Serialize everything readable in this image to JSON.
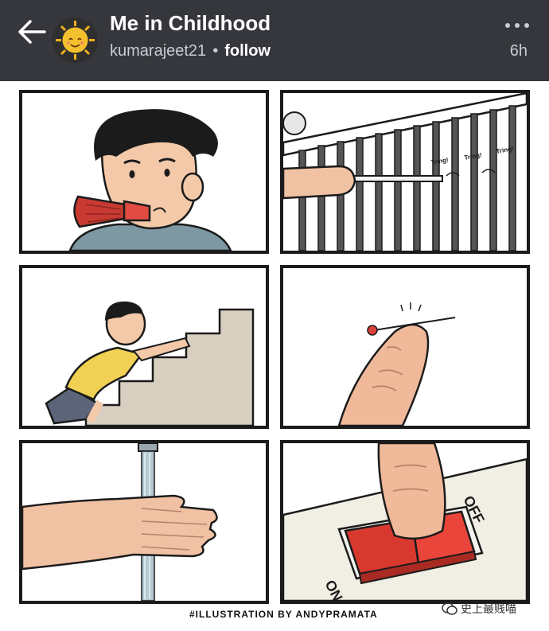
{
  "header": {
    "title": "Me in Childhood",
    "username": "kumarajeet21",
    "separator": "•",
    "follow_label": "follow",
    "timestamp": "6h",
    "back_icon": "arrow-left-icon",
    "more_icon": "more-horizontal-icon",
    "avatar_icon": "sun-avatar",
    "background_color": "#35373c"
  },
  "comic": {
    "panel_count": 6,
    "panels": [
      {
        "id": "party-horn",
        "text": ""
      },
      {
        "id": "railing",
        "text": "Tring! Tring! Tring!"
      },
      {
        "id": "stairs",
        "text": ""
      },
      {
        "id": "pin-finger",
        "text": ""
      },
      {
        "id": "water-hand",
        "text": ""
      },
      {
        "id": "switch",
        "on_label": "ON",
        "off_label": "OFF"
      }
    ],
    "credit": "#ILLUSTRATION BY ANDYPRAMATA"
  },
  "watermark": {
    "text": "史上最贱喵"
  }
}
